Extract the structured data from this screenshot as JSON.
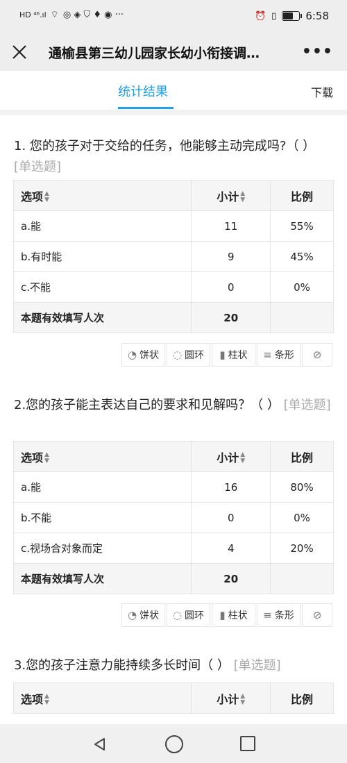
{
  "status": {
    "left_text": "HD ⁴⁶.ıl",
    "time": "6:58"
  },
  "header": {
    "title": "通榆县第三幼儿园家长幼小衔接调…",
    "more": "•••"
  },
  "tabs": {
    "active": "统计结果",
    "download": "下载"
  },
  "table_headers": {
    "option": "选项",
    "count": "小计",
    "ratio": "比例"
  },
  "total_label": "本题有效填写人次",
  "chart_buttons": {
    "pie": "饼状",
    "ring": "圆环",
    "bar": "柱状",
    "strip": "条形"
  },
  "questions": [
    {
      "title": "1. 您的孩子对于交给的任务，他能够主动完成吗?（ ）",
      "type": "[单选题]",
      "rows": [
        {
          "option": "a.能",
          "count": "11",
          "ratio": "55%"
        },
        {
          "option": "b.有时能",
          "count": "9",
          "ratio": "45%"
        },
        {
          "option": "c.不能",
          "count": "0",
          "ratio": "0%"
        }
      ],
      "total": "20"
    },
    {
      "title": "2.您的孩子能主表达自己的要求和见解吗？（ ）",
      "type": "[单选题]",
      "rows": [
        {
          "option": "a.能",
          "count": "16",
          "ratio": "80%"
        },
        {
          "option": "b.不能",
          "count": "0",
          "ratio": "0%"
        },
        {
          "option": "c.视场合对象而定",
          "count": "4",
          "ratio": "20%"
        }
      ],
      "total": "20"
    },
    {
      "title": "3.您的孩子注意力能持续多长时间（ ）",
      "type": "[单选题]"
    }
  ],
  "colors": {
    "accent": "#1e9fe8"
  }
}
